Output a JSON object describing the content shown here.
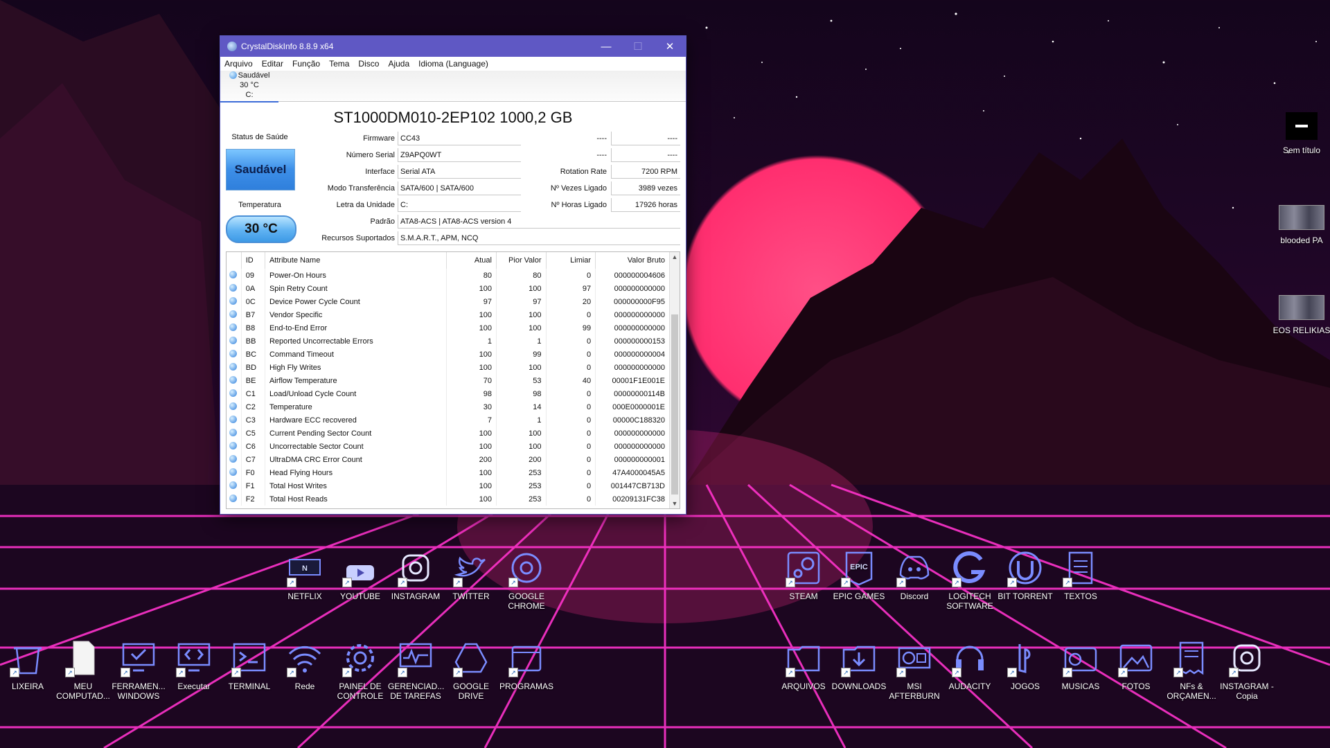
{
  "window": {
    "title": "CrystalDiskInfo 8.8.9 x64",
    "menu": [
      "Arquivo",
      "Editar",
      "Função",
      "Tema",
      "Disco",
      "Ajuda",
      "Idioma (Language)"
    ],
    "disk_tab": {
      "status": "Saudável",
      "temp": "30 °C",
      "drive": "C:"
    },
    "model": "ST1000DM010-2EP102 1000,2 GB",
    "health_label": "Status de Saúde",
    "health_value": "Saudável",
    "temp_label": "Temperatura",
    "temp_value": "30 °C",
    "fields": {
      "firmware_label": "Firmware",
      "firmware": "CC43",
      "serial_label": "Número Serial",
      "serial": "Z9APQ0WT",
      "interface_label": "Interface",
      "interface": "Serial ATA",
      "transfer_label": "Modo Transferência",
      "transfer": "SATA/600 | SATA/600",
      "letter_label": "Letra da Unidade",
      "letter": "C:",
      "standard_label": "Padrão",
      "standard": "ATA8-ACS | ATA8-ACS version 4",
      "features_label": "Recursos Suportados",
      "features": "S.M.A.R.T., APM, NCQ",
      "r1_label": "----",
      "r1": "----",
      "r2_label": "----",
      "r2": "----",
      "rotation_label": "Rotation Rate",
      "rotation": "7200 RPM",
      "poweron_count_label": "Nº Vezes Ligado",
      "poweron_count": "3989 vezes",
      "poweron_hours_label": "Nº Horas Ligado",
      "poweron_hours": "17926 horas"
    },
    "table": {
      "headers": [
        "ID",
        "Attribute Name",
        "Atual",
        "Pior Valor",
        "Limiar",
        "Valor Bruto"
      ],
      "rows": [
        [
          "09",
          "Power-On Hours",
          "80",
          "80",
          "0",
          "000000004606"
        ],
        [
          "0A",
          "Spin Retry Count",
          "100",
          "100",
          "97",
          "000000000000"
        ],
        [
          "0C",
          "Device Power Cycle Count",
          "97",
          "97",
          "20",
          "000000000F95"
        ],
        [
          "B7",
          "Vendor Specific",
          "100",
          "100",
          "0",
          "000000000000"
        ],
        [
          "B8",
          "End-to-End Error",
          "100",
          "100",
          "99",
          "000000000000"
        ],
        [
          "BB",
          "Reported Uncorrectable Errors",
          "1",
          "1",
          "0",
          "000000000153"
        ],
        [
          "BC",
          "Command Timeout",
          "100",
          "99",
          "0",
          "000000000004"
        ],
        [
          "BD",
          "High Fly Writes",
          "100",
          "100",
          "0",
          "000000000000"
        ],
        [
          "BE",
          "Airflow Temperature",
          "70",
          "53",
          "40",
          "00001F1E001E"
        ],
        [
          "C1",
          "Load/Unload Cycle Count",
          "98",
          "98",
          "0",
          "00000000114B"
        ],
        [
          "C2",
          "Temperature",
          "30",
          "14",
          "0",
          "000E0000001E"
        ],
        [
          "C3",
          "Hardware ECC recovered",
          "7",
          "1",
          "0",
          "00000C188320"
        ],
        [
          "C5",
          "Current Pending Sector Count",
          "100",
          "100",
          "0",
          "000000000000"
        ],
        [
          "C6",
          "Uncorrectable Sector Count",
          "100",
          "100",
          "0",
          "000000000000"
        ],
        [
          "C7",
          "UltraDMA CRC Error Count",
          "200",
          "200",
          "0",
          "000000000001"
        ],
        [
          "F0",
          "Head Flying Hours",
          "100",
          "253",
          "0",
          "47A4000045A5"
        ],
        [
          "F1",
          "Total Host Writes",
          "100",
          "253",
          "0",
          "001447CB713D"
        ],
        [
          "F2",
          "Total Host Reads",
          "100",
          "253",
          "0",
          "00209131FC38"
        ]
      ]
    }
  },
  "desktop": {
    "row1_left": [
      {
        "label": "NETFLIX",
        "icon": "netflix-icon"
      },
      {
        "label": "YOUTUBE",
        "icon": "youtube-icon"
      },
      {
        "label": "INSTAGRAM",
        "icon": "instagram-icon"
      },
      {
        "label": "TWITTER",
        "icon": "twitter-icon"
      },
      {
        "label": "GOOGLE CHROME",
        "icon": "chrome-icon"
      }
    ],
    "row1_right": [
      {
        "label": "STEAM",
        "icon": "steam-icon"
      },
      {
        "label": "EPIC GAMES",
        "icon": "epic-games-icon"
      },
      {
        "label": "Discord",
        "icon": "discord-icon"
      },
      {
        "label": "LOGITECH SOFTWARE",
        "icon": "logitech-icon"
      },
      {
        "label": "BIT TORRENT",
        "icon": "bittorrent-icon"
      },
      {
        "label": "TEXTOS",
        "icon": "document-icon"
      }
    ],
    "row2_left": [
      {
        "label": "LIXEIRA",
        "icon": "recycle-bin-icon"
      },
      {
        "label": "MEU COMPUTAD...",
        "icon": "file-icon"
      },
      {
        "label": "FERRAMEN... WINDOWS",
        "icon": "monitor-check-icon"
      },
      {
        "label": "Executar",
        "icon": "code-monitor-icon"
      },
      {
        "label": "TERMINAL",
        "icon": "terminal-icon"
      },
      {
        "label": "Rede",
        "icon": "wifi-icon"
      },
      {
        "label": "PAINEL DE CONTROLE",
        "icon": "control-panel-icon"
      },
      {
        "label": "GERENCIAD... DE TAREFAS",
        "icon": "task-manager-icon"
      },
      {
        "label": "GOOGLE DRIVE",
        "icon": "drive-icon"
      },
      {
        "label": "PROGRAMAS",
        "icon": "programs-icon"
      }
    ],
    "row2_right": [
      {
        "label": "ARQUIVOS",
        "icon": "folder-icon"
      },
      {
        "label": "DOWNLOADS",
        "icon": "download-icon"
      },
      {
        "label": "MSI AFTERBURN",
        "icon": "gpu-icon"
      },
      {
        "label": "AUDACITY",
        "icon": "audio-icon"
      },
      {
        "label": "JOGOS",
        "icon": "playstation-icon"
      },
      {
        "label": "MUSICAS",
        "icon": "radio-icon"
      },
      {
        "label": "FOTOS",
        "icon": "photos-icon"
      },
      {
        "label": "NFs & ORÇAMEN...",
        "icon": "receipt-icon"
      },
      {
        "label": "INSTAGRAM - Copia",
        "icon": "instagram-copy-icon"
      }
    ],
    "right_column": [
      {
        "label": "Sem título"
      },
      {
        "label": "blooded PA"
      },
      {
        "label": "EOS RELIKIAS"
      }
    ]
  }
}
